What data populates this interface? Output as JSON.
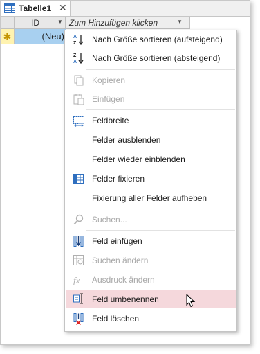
{
  "tab": {
    "title": "Tabelle1",
    "icon": "table-icon",
    "close_glyph": "✕"
  },
  "grid": {
    "columns": [
      {
        "label": "ID",
        "dropdown": "▼"
      },
      {
        "label": "Zum Hinzufügen klicken",
        "dropdown": "▼"
      }
    ],
    "new_row": {
      "marker": "✱",
      "value": "(Neu)"
    }
  },
  "menu": {
    "items": [
      {
        "label": "Nach Größe sortieren (aufsteigend)",
        "icon": "sort-ascending-icon",
        "disabled": false
      },
      {
        "label": "Nach Größe sortieren (absteigend)",
        "icon": "sort-descending-icon",
        "disabled": false
      },
      {
        "label": "Kopieren",
        "icon": "copy-icon",
        "disabled": true
      },
      {
        "label": "Einfügen",
        "icon": "paste-icon",
        "disabled": true
      },
      {
        "label": "Feldbreite",
        "icon": "field-width-icon",
        "disabled": false
      },
      {
        "label": "Felder ausblenden",
        "icon": "",
        "disabled": false
      },
      {
        "label": "Felder wieder einblenden",
        "icon": "",
        "disabled": false
      },
      {
        "label": "Felder fixieren",
        "icon": "freeze-fields-icon",
        "disabled": false
      },
      {
        "label": "Fixierung aller Felder aufheben",
        "icon": "",
        "disabled": false
      },
      {
        "label": "Suchen...",
        "icon": "search-icon",
        "disabled": true
      },
      {
        "label": "Feld einfügen",
        "icon": "insert-field-icon",
        "disabled": false
      },
      {
        "label": "Suchen ändern",
        "icon": "modify-lookup-icon",
        "disabled": true
      },
      {
        "label": "Ausdruck ändern",
        "icon": "expression-icon",
        "disabled": true
      },
      {
        "label": "Feld umbenennen",
        "icon": "rename-field-icon",
        "disabled": false,
        "highlighted": true
      },
      {
        "label": "Feld löschen",
        "icon": "delete-field-icon",
        "disabled": false
      }
    ]
  },
  "colors": {
    "accent": "#2f6fbf",
    "highlight": "#f5d8dc",
    "new_row_marker": "#fff3b0",
    "id_cell": "#a8d0f0"
  }
}
